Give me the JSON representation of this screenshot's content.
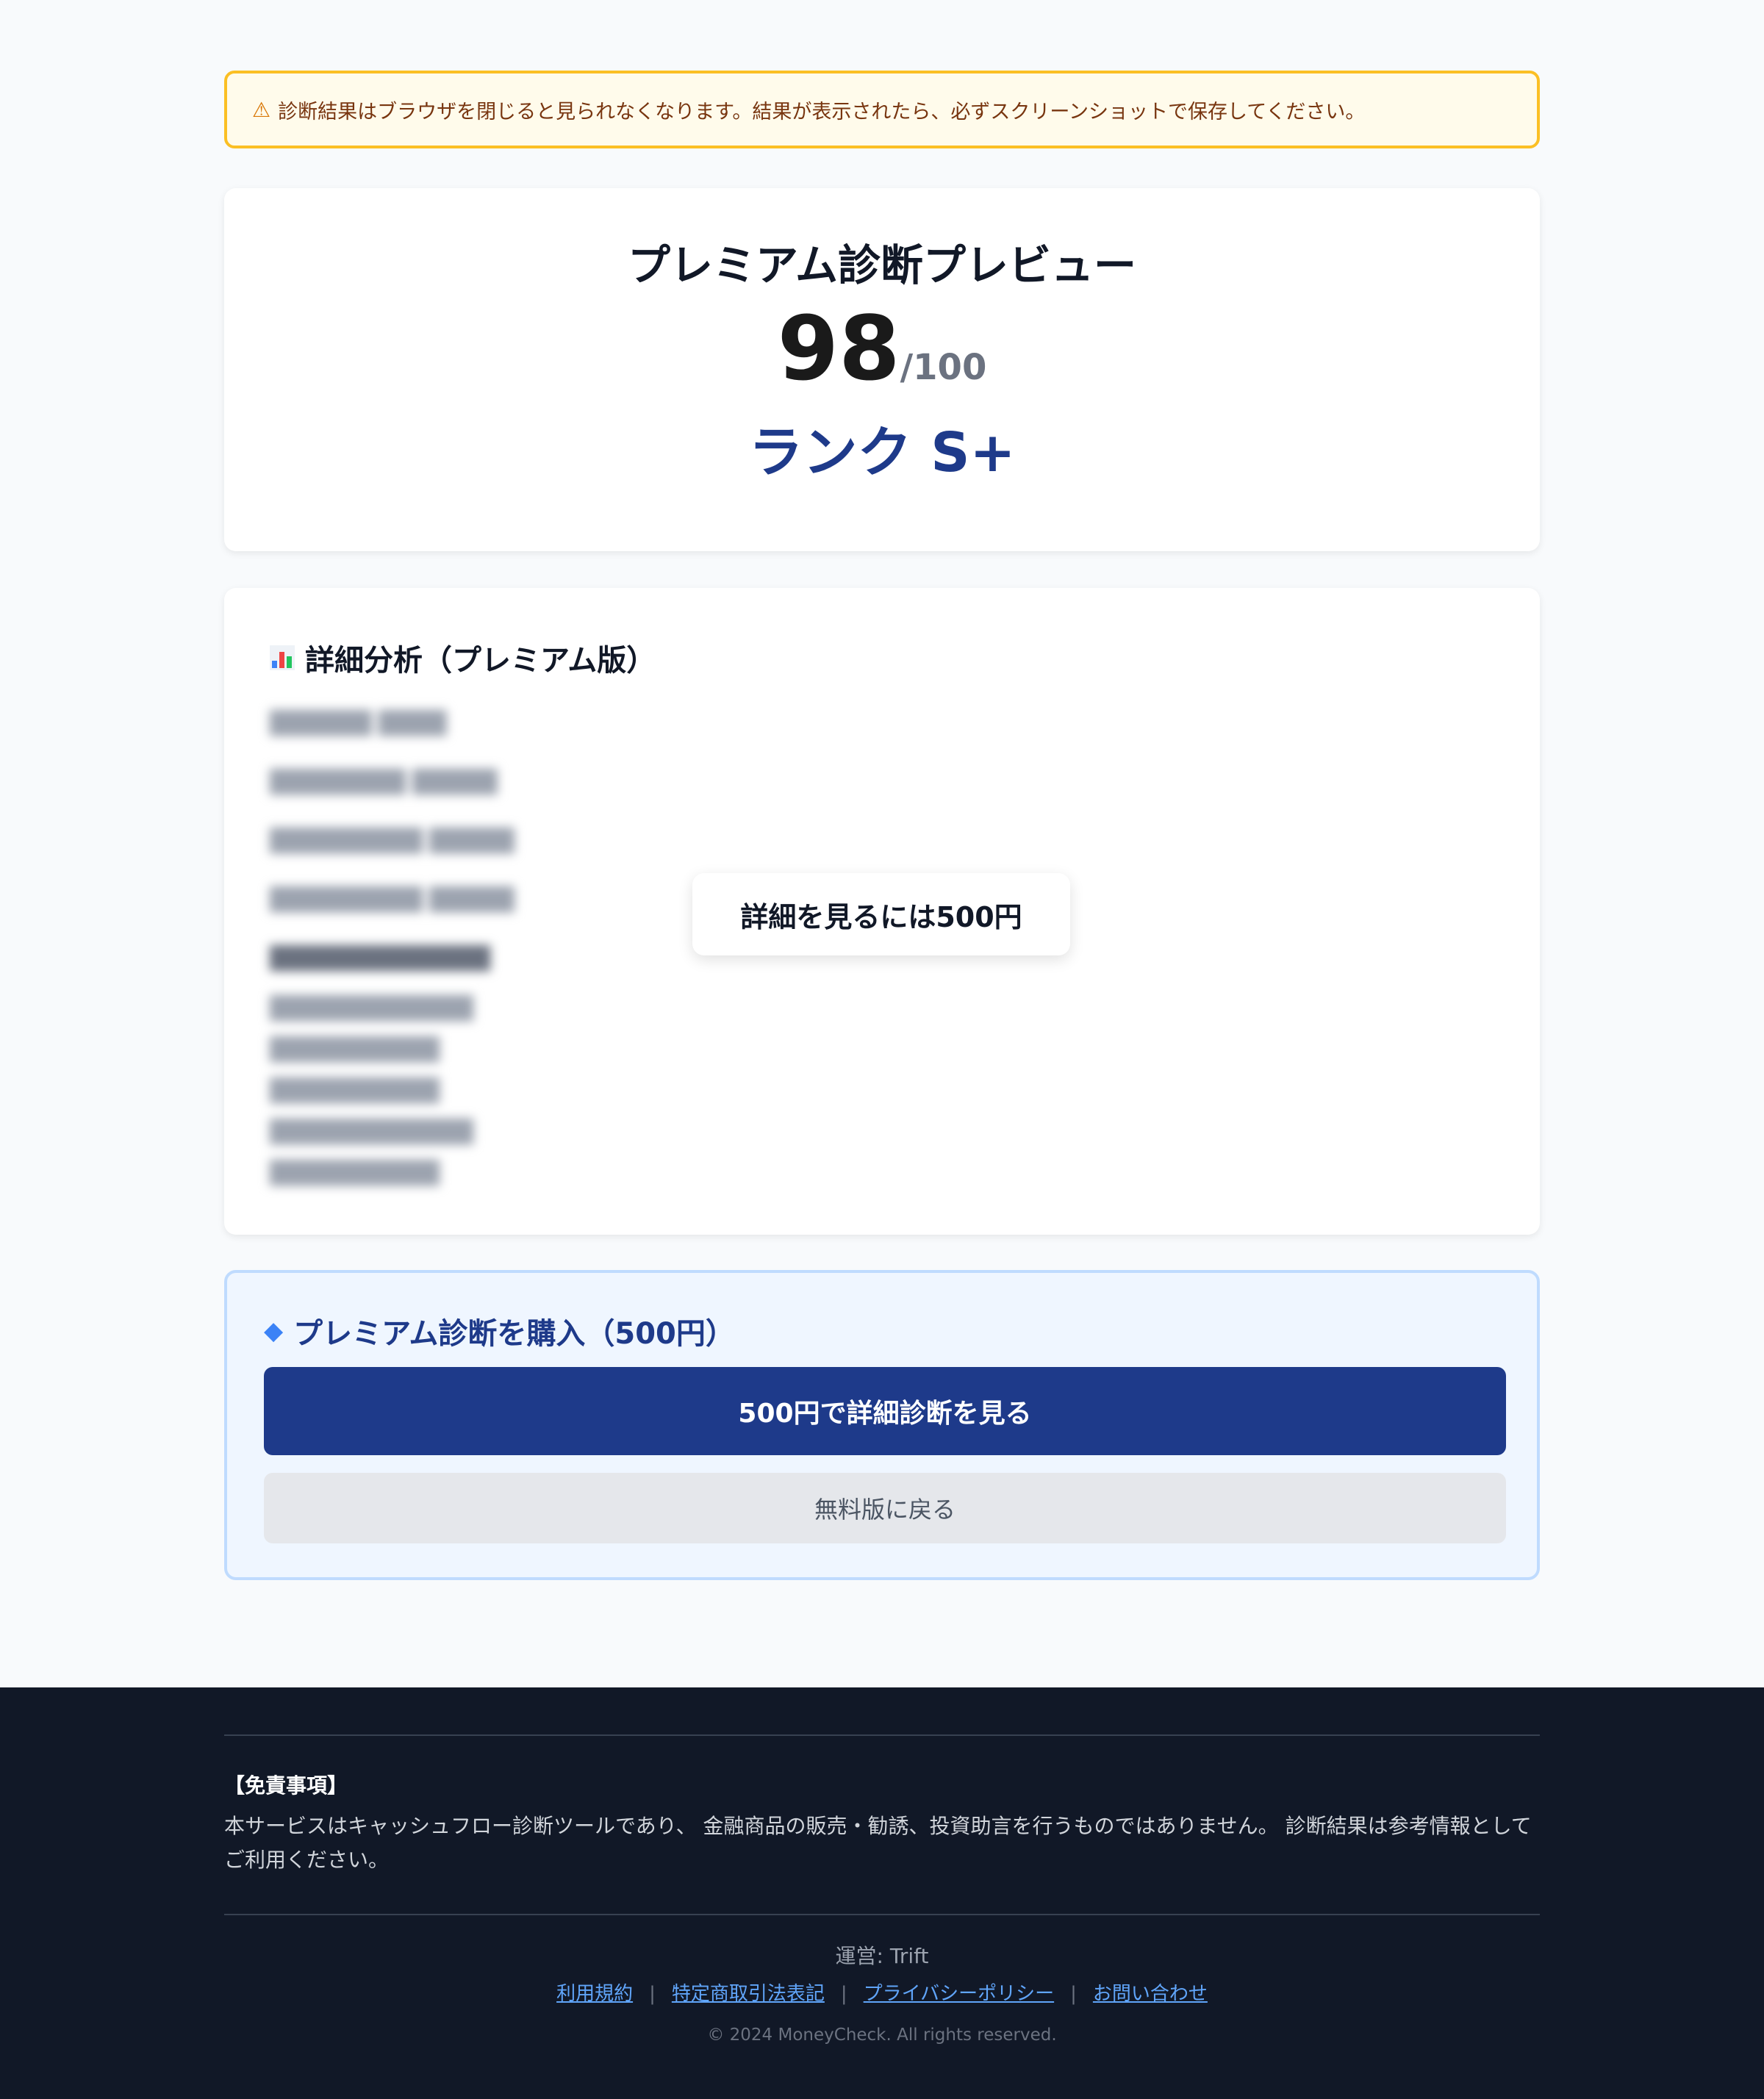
{
  "warning": {
    "icon": "warning-icon",
    "text": "診断結果はブラウザを閉じると見られなくなります。結果が表示されたら、必ずスクリーンショットで保存してください。"
  },
  "score_card": {
    "title": "プレミアム診断プレビュー",
    "score": "98",
    "score_max": "/100",
    "rank": "ランク S+"
  },
  "detail": {
    "icon": "bar-chart-icon",
    "heading": "詳細分析（プレミアム版）",
    "lock_label": "詳細を見るには500円"
  },
  "purchase": {
    "icon": "gem-icon",
    "heading": "プレミアム診断を購入（500円）",
    "primary_button": "500円で詳細診断を見る",
    "secondary_button": "無料版に戻る"
  },
  "footer": {
    "disclaimer_title": "【免責事項】",
    "disclaimer_body": "本サービスはキャッシュフロー診断ツールであり、 金融商品の販売・勧誘、投資助言を行うものではありません。 診断結果は参考情報としてご利用ください。",
    "operator": "運営: Trift",
    "links": [
      "利用規約",
      "特定商取引法表記",
      "プライバシーポリシー",
      "お問い合わせ"
    ],
    "separator": "|",
    "copyright": "© 2024 MoneyCheck. All rights reserved."
  },
  "colors": {
    "brand": "#1e3a8a",
    "warning_border": "#fbbf24",
    "footer_bg": "#111827",
    "link": "#60a5fa"
  }
}
